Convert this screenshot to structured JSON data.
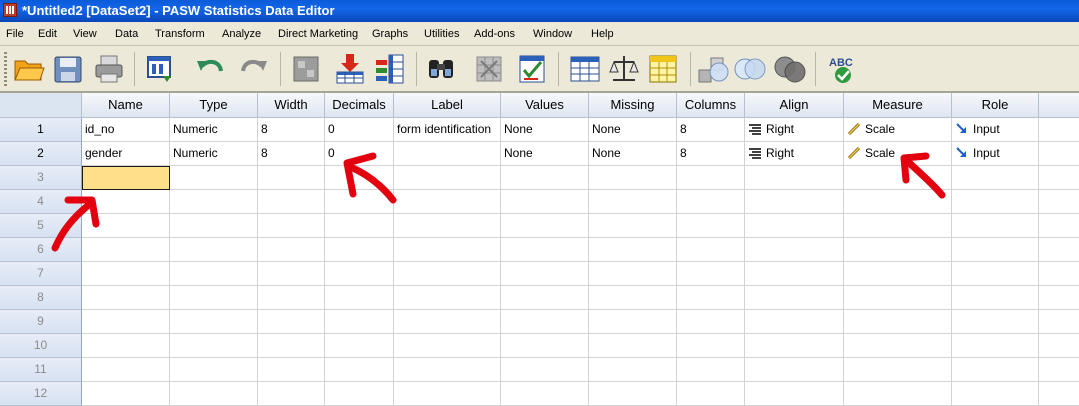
{
  "window": {
    "title": "*Untitled2 [DataSet2] - PASW Statistics Data Editor"
  },
  "menu": [
    "File",
    "Edit",
    "View",
    "Data",
    "Transform",
    "Analyze",
    "Direct Marketing",
    "Graphs",
    "Utilities",
    "Add-ons",
    "Window",
    "Help"
  ],
  "toolbar": {
    "icons": [
      "open-folder-icon",
      "save-icon",
      "print-icon",
      "dialog-recall-icon",
      "undo-icon",
      "redo-icon",
      "go-to-case-icon",
      "insert-cases-icon",
      "insert-variable-icon",
      "find-icon",
      "split-file-icon",
      "select-cases-icon",
      "weight-cases-icon",
      "value-labels-icon",
      "use-variable-sets-icon",
      "show-all-variables-icon",
      "spell-check-icon"
    ],
    "spell_label": "ABC"
  },
  "columns": [
    "Name",
    "Type",
    "Width",
    "Decimals",
    "Label",
    "Values",
    "Missing",
    "Columns",
    "Align",
    "Measure",
    "Role"
  ],
  "row_numbers": [
    "1",
    "2",
    "3",
    "4",
    "5",
    "6",
    "7",
    "8",
    "9",
    "10",
    "11",
    "12"
  ],
  "rows": [
    {
      "name": "id_no",
      "type": "Numeric",
      "width": "8",
      "decimals": "0",
      "label": "form identification",
      "values": "None",
      "missing": "None",
      "columns": "8",
      "align": "Right",
      "measure": "Scale",
      "role": "Input"
    },
    {
      "name": "gender",
      "type": "Numeric",
      "width": "8",
      "decimals": "0",
      "label": "",
      "values": "None",
      "missing": "None",
      "columns": "8",
      "align": "Right",
      "measure": "Scale",
      "role": "Input"
    }
  ],
  "colors": {
    "annotation": "#e3000f",
    "active_cell": "#ffe08a",
    "titlebar": "#0a5bd8"
  }
}
